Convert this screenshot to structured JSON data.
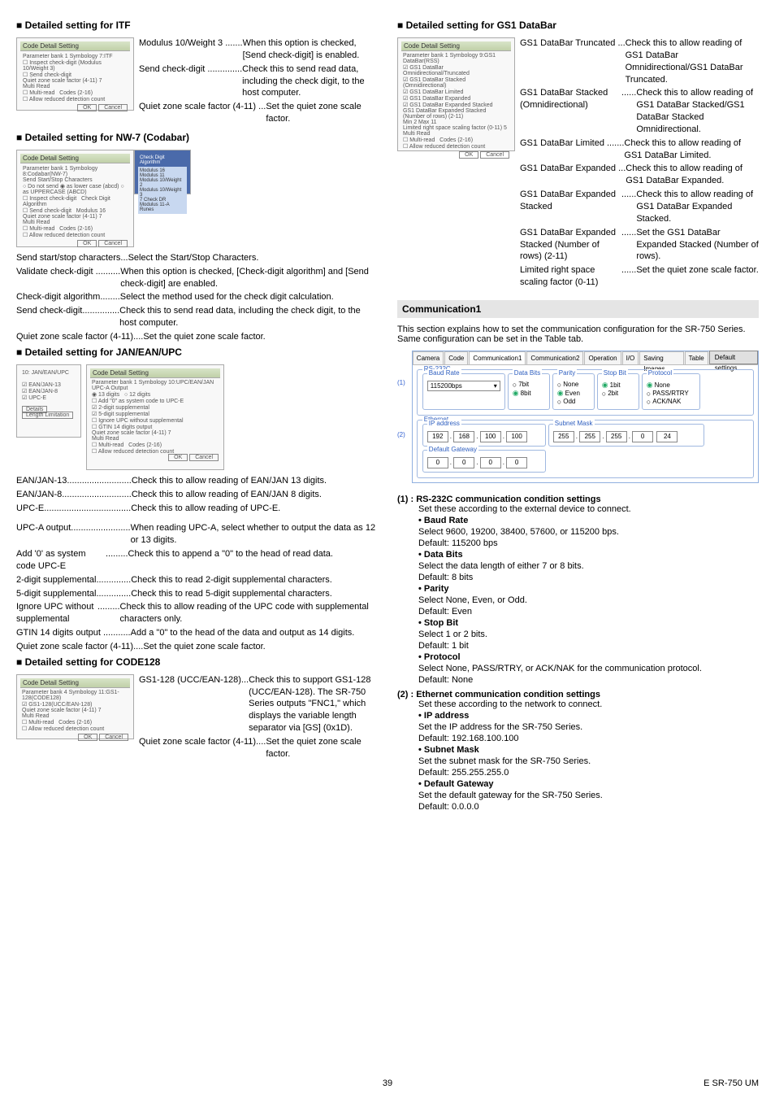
{
  "page_number": "39",
  "footer_right": "E SR-750 UM",
  "left": {
    "itf_heading": "■ Detailed setting for ITF",
    "itf_panel_title": "Code Detail Setting",
    "itf_item1_label": "Modulus 10/Weight 3 .......",
    "itf_item1_desc": "When this option is checked, [Send check-digit] is enabled.",
    "itf_item2_label": "Send check-digit ..............",
    "itf_item2_desc": "Check this to send read data, including the check digit, to the host computer.",
    "itf_item3_label": "Quiet zone scale factor (4-11) ...",
    "itf_item3_desc": "Set the quiet zone scale factor.",
    "nw7_heading": "■ Detailed setting for NW-7 (Codabar)",
    "nw7_panel_title": "Code Detail Setting",
    "nw7_side_title": "Check Digit Algorithm",
    "nw7_item1_label": "Send start/stop characters...",
    "nw7_item1_desc": "Select the Start/Stop Characters.",
    "nw7_item2_label": "Validate check-digit ..........",
    "nw7_item2_desc": "When this option is checked, [Check-digit algorithm] and [Send check-digit] are enabled.",
    "nw7_item3_label": "Check-digit algorithm........",
    "nw7_item3_desc": "Select the method used for the check digit calculation.",
    "nw7_item4_label": "Send check-digit...............",
    "nw7_item4_desc": "Check this to send read data, including the check digit, to the host computer.",
    "nw7_item5_label": "Quiet zone scale factor (4-11)....",
    "nw7_item5_desc": "Set the quiet zone scale factor.",
    "jan_heading": "■ Detailed setting for JAN/EAN/UPC",
    "jan_panel_title": "Code Detail Setting",
    "jan_i1_label": "EAN/JAN-13..........................",
    "jan_i1_desc": "Check this to allow reading of EAN/JAN 13 digits.",
    "jan_i2_label": "EAN/JAN-8............................",
    "jan_i2_desc": "Check this to allow reading of EAN/JAN 8 digits.",
    "jan_i3_label": "UPC-E...................................",
    "jan_i3_desc": "Check this to allow reading of UPC-E.",
    "jan_i4_label": "UPC-A output........................",
    "jan_i4_desc": "When reading UPC-A, select whether to output the data as 12 or 13 digits.",
    "jan_i5_label": "Add '0' as system code UPC-E",
    "jan_i5_dots": ".........",
    "jan_i5_desc": "Check this to append a \"0\" to the head of read data.",
    "jan_i6_label": "2-digit supplemental..............",
    "jan_i6_desc": "Check this to read 2-digit supplemental characters.",
    "jan_i7_label": "5-digit supplemental..............",
    "jan_i7_desc": "Check this to read 5-digit supplemental characters.",
    "jan_i8_label": "Ignore UPC without supplemental",
    "jan_i8_dots": ".........",
    "jan_i8_desc": "Check this to allow reading of the UPC code with supplemental characters only.",
    "jan_i9_label": "GTIN 14 digits output ...........",
    "jan_i9_desc": "Add a \"0\" to the head of the data and output as 14 digits.",
    "jan_i10_label": "Quiet zone scale factor (4-11)....",
    "jan_i10_desc": "Set the quiet zone scale factor.",
    "c128_heading": "■ Detailed setting for CODE128",
    "c128_panel_title": "Code Detail Setting",
    "c128_i1_label": "GS1-128 (UCC/EAN-128)...",
    "c128_i1_desc": "Check this to support GS1-128 (UCC/EAN-128). The SR-750 Series outputs \"FNC1,\" which displays the variable length separator via [GS] (0x1D).",
    "c128_i2_label": "Quiet zone scale factor (4-11)....",
    "c128_i2_desc": "Set the quiet zone scale factor."
  },
  "right": {
    "gs1_heading": "■ Detailed setting for GS1 DataBar",
    "gs1_panel_title": "Code Detail Setting",
    "gs1_i1_label": "GS1 DataBar Truncated ...",
    "gs1_i1_desc": "Check this to allow reading of GS1 DataBar Omnidirectional/GS1 DataBar Truncated.",
    "gs1_i2_label": "GS1 DataBar Stacked (Omnidirectional)",
    "gs1_i2_dots": "......",
    "gs1_i2_desc": "Check this to allow reading of GS1 DataBar Stacked/GS1 DataBar Stacked Omnidirectional.",
    "gs1_i3_label": "GS1 DataBar Limited .......",
    "gs1_i3_desc": "Check this to allow reading of GS1 DataBar Limited.",
    "gs1_i4_label": "GS1 DataBar Expanded ...",
    "gs1_i4_desc": "Check this to allow reading of GS1 DataBar Expanded.",
    "gs1_i5_label": "GS1 DataBar Expanded Stacked",
    "gs1_i5_dots": "......",
    "gs1_i5_desc": "Check this to allow reading of GS1 DataBar Expanded Stacked.",
    "gs1_i6_label": "GS1 DataBar Expanded Stacked (Number of rows) (2-11)",
    "gs1_i6_dots": "......",
    "gs1_i6_desc": "Set the GS1 DataBar Expanded Stacked (Number of rows).",
    "gs1_i7_label": "Limited right space scaling factor (0-11)",
    "gs1_i7_dots": "......",
    "gs1_i7_desc": "Set the quiet zone scale factor.",
    "comm_header": "Communication1",
    "comm_intro": "This section explains how to set the communication configuration for the SR-750 Series. Same configuration can be set in the Table tab.",
    "ptr1": "(1)",
    "ptr2": "(2)",
    "tabs": {
      "camera": "Camera",
      "code": "Code",
      "comm1": "Communication1",
      "comm2": "Communication2",
      "op": "Operation",
      "io": "I/O",
      "save": "Saving Images",
      "table": "Table",
      "dflt": "Default settings"
    },
    "rs232c": {
      "section": "RS-232C",
      "baud": "Baud Rate",
      "baud_val": "115200bps",
      "databits": "Data Bits",
      "db7": "7bit",
      "db8": "8bit",
      "parity": "Parity",
      "pnone": "None",
      "peven": "Even",
      "podd": "Odd",
      "stopbit": "Stop Bit",
      "sb1": "1bit",
      "sb2": "2bit",
      "proto": "Protocol",
      "prnone": "None",
      "prpass": "PASS/RTRY",
      "prack": "ACK/NAK"
    },
    "eth": {
      "section": "Ethernet",
      "ip": "IP address",
      "ip1": "192",
      "ip2": "168",
      "ip3": "100",
      "ip4": "100",
      "sub": "Subnet Mask",
      "s1": "255",
      "s2": "255",
      "s3": "255",
      "s4": "0",
      "s5": "24",
      "gw": "Default Gateway",
      "g1": "0",
      "g2": "0",
      "g3": "0",
      "g4": "0"
    },
    "h1": "(1) :  RS-232C communication condition settings",
    "h1_intro": "Set these according to the external device to connect.",
    "b_baud": "• Baud Rate",
    "b_baud_1": "Select 9600, 19200, 38400, 57600, or 115200 bps.",
    "b_baud_2": "Default: 115200 bps",
    "b_data": "• Data Bits",
    "b_data_1": "Select the data length of either 7 or 8 bits.",
    "b_data_2": "Default: 8 bits",
    "b_parity": "• Parity",
    "b_parity_1": "Select None, Even, or Odd.",
    "b_parity_2": "Default: Even",
    "b_stop": "• Stop Bit",
    "b_stop_1": "Select 1 or 2 bits.",
    "b_stop_2": "Default: 1 bit",
    "b_proto": "• Protocol",
    "b_proto_1": "Select None, PASS/RTRY, or ACK/NAK for the communication protocol.",
    "b_proto_2": "Default: None",
    "h2": "(2) :  Ethernet communication condition settings",
    "h2_intro": "Set these according to the network to connect.",
    "b_ip": "• IP address",
    "b_ip_1": "Set the IP address for the SR-750 Series.",
    "b_ip_2": "Default: 192.168.100.100",
    "b_sub": "• Subnet Mask",
    "b_sub_1": "Set the subnet mask for the SR-750 Series.",
    "b_sub_2": "Default: 255.255.255.0",
    "b_gw": "• Default Gateway",
    "b_gw_1": "Set the default gateway for the SR-750 Series.",
    "b_gw_2": "Default: 0.0.0.0"
  }
}
